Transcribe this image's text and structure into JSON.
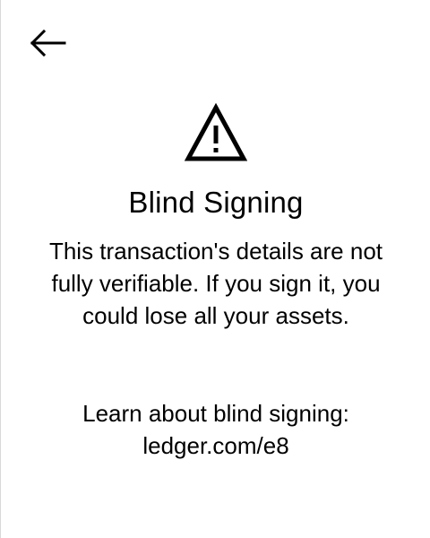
{
  "screen": {
    "title": "Blind Signing",
    "message": "This transaction's details are not fully verifiable. If you sign it, you could lose all your assets.",
    "learn_label": "Learn about blind signing:",
    "learn_link": "ledger.com/e8"
  },
  "icons": {
    "back": "arrow-left-icon",
    "warning": "warning-triangle-icon"
  },
  "colors": {
    "text": "#000000",
    "background": "#ffffff"
  }
}
